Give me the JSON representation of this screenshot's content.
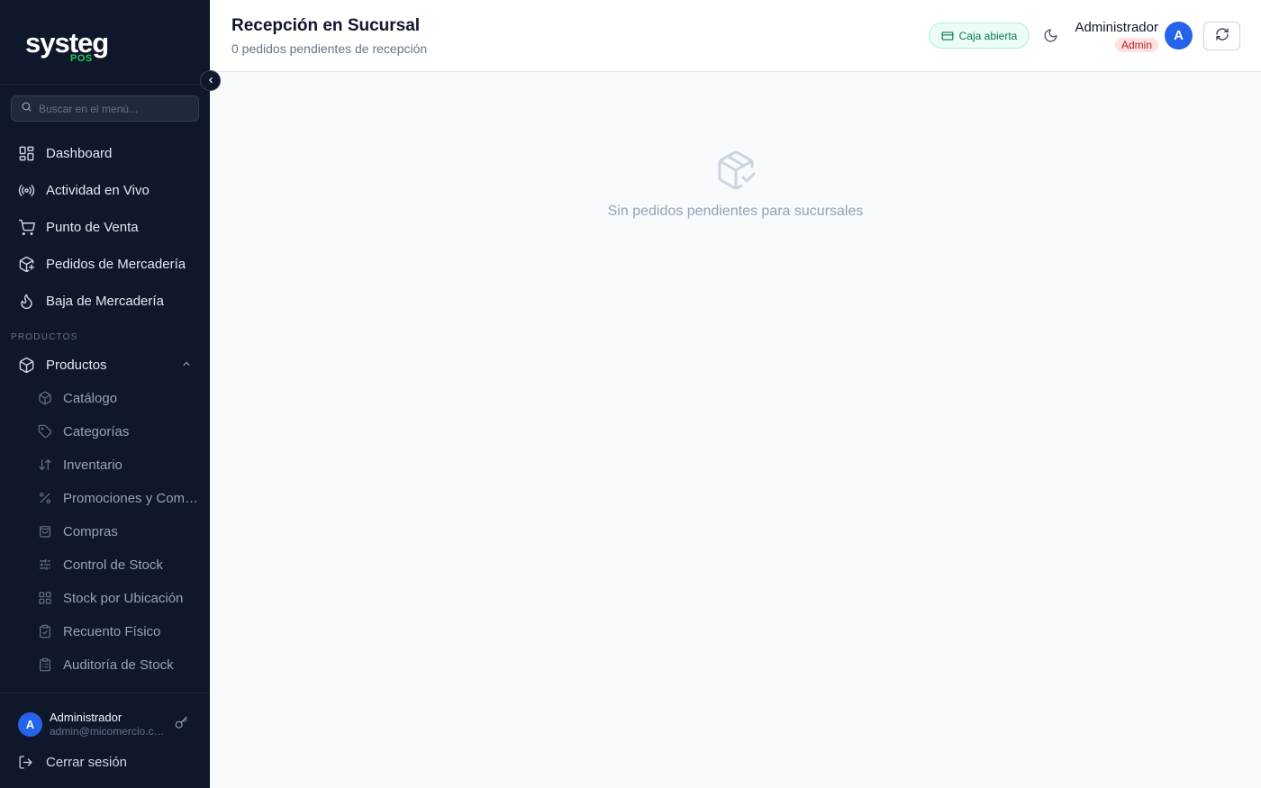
{
  "brand": {
    "name": "systeg",
    "sub": "POS",
    "accent": "#22c55e"
  },
  "sidebar": {
    "search_placeholder": "Buscar en el menú...",
    "items": [
      {
        "label": "Dashboard",
        "icon": "layout-grid-icon"
      },
      {
        "label": "Actividad en Vivo",
        "icon": "radio-icon"
      },
      {
        "label": "Punto de Venta",
        "icon": "cart-icon"
      },
      {
        "label": "Pedidos de Mercadería",
        "icon": "package-plus-icon"
      },
      {
        "label": "Baja de Mercadería",
        "icon": "flame-icon"
      }
    ],
    "section_label": "PRODUCTOS",
    "group": {
      "label": "Productos",
      "icon": "box-icon",
      "expanded": true
    },
    "sub_items": [
      {
        "label": "Catálogo",
        "icon": "box-icon"
      },
      {
        "label": "Categorías",
        "icon": "tag-icon"
      },
      {
        "label": "Inventario",
        "icon": "arrows-up-down-icon"
      },
      {
        "label": "Promociones y Combos",
        "icon": "percent-icon"
      },
      {
        "label": "Compras",
        "icon": "shopping-bag-icon"
      },
      {
        "label": "Control de Stock",
        "icon": "sliders-icon"
      },
      {
        "label": "Stock por Ubicación",
        "icon": "grid-icon"
      },
      {
        "label": "Recuento Físico",
        "icon": "clipboard-check-icon"
      },
      {
        "label": "Auditoría de Stock",
        "icon": "clipboard-list-icon"
      }
    ],
    "user": {
      "initial": "A",
      "name": "Administrador",
      "email": "admin@micomercio.com"
    },
    "logout_label": "Cerrar sesión"
  },
  "header": {
    "title": "Recepción en Sucursal",
    "subtitle": "0 pedidos pendientes de recepción",
    "caja_label": "Caja abierta",
    "user_name": "Administrador",
    "user_role": "Admin",
    "avatar_initial": "A"
  },
  "main": {
    "empty_text": "Sin pedidos pendientes para sucursales"
  }
}
